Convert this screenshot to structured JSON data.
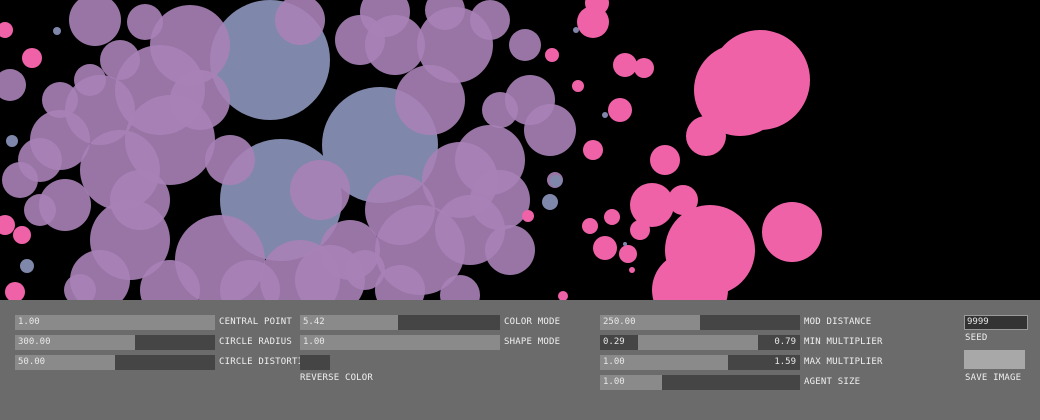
{
  "canvas": {
    "background": "#000000",
    "colors": {
      "pink": "#f062a8",
      "purple": "#a982b7",
      "slate": "#7f87aa"
    }
  },
  "controls": {
    "central_point": {
      "label": "CENTRAL POINT",
      "value": "1.00",
      "level": 1.0
    },
    "circle_radius": {
      "label": "CIRCLE RADIUS",
      "value": "300.00",
      "level": 0.6
    },
    "circle_distortion": {
      "label": "CIRCLE DISTORTION",
      "value": "50.00",
      "level": 0.5
    },
    "color_mode": {
      "label": "COLOR MODE",
      "value": "5.42",
      "level": 0.49
    },
    "shape_mode": {
      "label": "SHAPE MODE",
      "value": "1.00",
      "level": 1.0
    },
    "reverse_color": {
      "label": "REVERSE COLOR",
      "checked": false
    },
    "mod_distance": {
      "label": "MOD DISTANCE",
      "value": "250.00",
      "level": 0.5
    },
    "min_multiplier": {
      "label": "MIN MULTIPLIER",
      "low": "0.29",
      "high": "0.79",
      "range": [
        0.19,
        0.79
      ]
    },
    "max_multiplier": {
      "label": "MAX MULTIPLIER",
      "low": "1.00",
      "high": "1.59",
      "range": [
        0.0,
        0.64
      ]
    },
    "agent_size": {
      "label": "AGENT SIZE",
      "value": "1.00",
      "level": 0.31
    },
    "seed": {
      "label": "SEED",
      "value": "9999"
    },
    "save_image": {
      "label": "SAVE IMAGE"
    }
  }
}
